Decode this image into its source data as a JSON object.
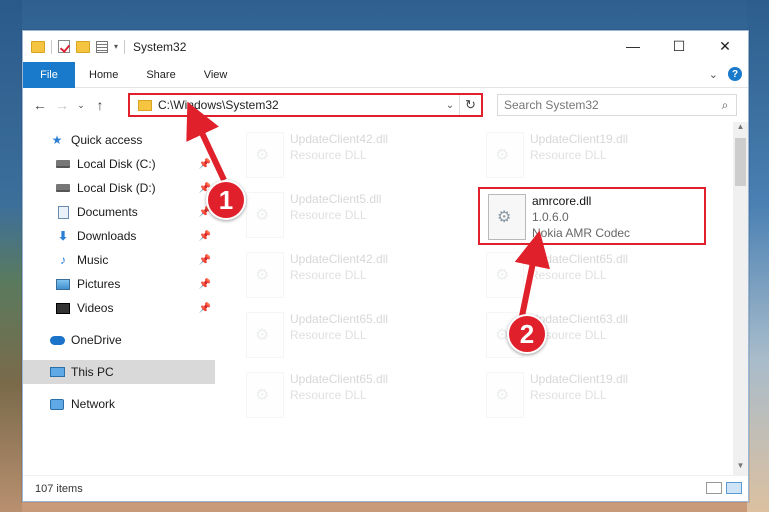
{
  "window": {
    "title": "System32",
    "controls": {
      "minimize": "—",
      "maximize": "☐",
      "close": "✕"
    }
  },
  "ribbon": {
    "tabs": [
      "File",
      "Home",
      "Share",
      "View"
    ]
  },
  "address": {
    "path": "C:\\Windows\\System32",
    "search_placeholder": "Search System32"
  },
  "sidebar": {
    "items": [
      {
        "label": "Quick access",
        "icon": "star-icon"
      },
      {
        "label": "Local Disk (C:)",
        "icon": "disk-icon",
        "pinned": true
      },
      {
        "label": "Local Disk (D:)",
        "icon": "disk-icon",
        "pinned": true
      },
      {
        "label": "Documents",
        "icon": "documents-icon",
        "pinned": true
      },
      {
        "label": "Downloads",
        "icon": "downloads-icon",
        "pinned": true
      },
      {
        "label": "Music",
        "icon": "music-icon",
        "pinned": true
      },
      {
        "label": "Pictures",
        "icon": "pictures-icon",
        "pinned": true
      },
      {
        "label": "Videos",
        "icon": "videos-icon",
        "pinned": true
      },
      {
        "label": "OneDrive",
        "icon": "onedrive-icon"
      },
      {
        "label": "This PC",
        "icon": "this-pc-icon",
        "selected": true
      },
      {
        "label": "Network",
        "icon": "network-icon"
      }
    ]
  },
  "files": [
    {
      "name": "UpdateClient42.dll",
      "type": "Resource DLL"
    },
    {
      "name": "UpdateClient19.dll",
      "type": "Resource DLL"
    },
    {
      "name": "UpdateClient5.dll",
      "type": "Resource DLL"
    },
    {
      "name": "UpdateClient42.dll",
      "type": "Resource DLL"
    },
    {
      "name": "UpdateClient65.dll",
      "type": "Resource DLL"
    },
    {
      "name": "UpdateClient65.dll",
      "type": "Resource DLL"
    },
    {
      "name": "UpdateClient63.dll",
      "type": "Resource DLL"
    },
    {
      "name": "UpdateClient65.dll",
      "type": "Resource DLL"
    },
    {
      "name": "UpdateClient19.dll",
      "type": "Resource DLL"
    }
  ],
  "highlighted_file": {
    "name": "amrcore.dll",
    "version": "1.0.6.0",
    "description": "Nokia AMR Codec"
  },
  "status": {
    "count": "107 items"
  },
  "annotations": {
    "step1": "1",
    "step2": "2"
  },
  "colors": {
    "accent": "#1979ca",
    "highlight": "#e0202a"
  }
}
